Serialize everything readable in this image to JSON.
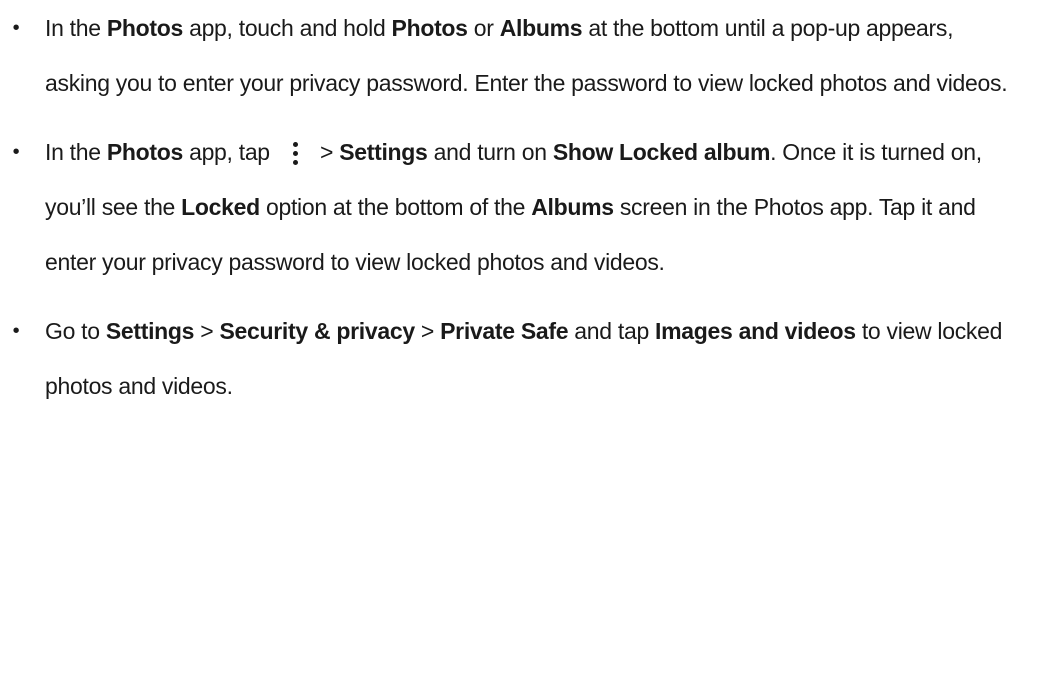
{
  "bullet_glyph": "•",
  "icons": {
    "more": "more-vertical-icon"
  },
  "items": [
    {
      "segments": [
        {
          "t": "In the "
        },
        {
          "t": "Photos",
          "b": true
        },
        {
          "t": " app, touch and hold "
        },
        {
          "t": "Photos",
          "b": true
        },
        {
          "t": " or "
        },
        {
          "t": "Albums",
          "b": true
        },
        {
          "t": " at the bottom until a pop-up appears, asking you to enter your privacy password. Enter the password to view locked photos and videos."
        }
      ]
    },
    {
      "segments": [
        {
          "t": "In the "
        },
        {
          "t": "Photos",
          "b": true
        },
        {
          "t": " app, tap "
        },
        {
          "icon": "more-vertical-icon"
        },
        {
          "t": " > "
        },
        {
          "t": "Settings",
          "b": true
        },
        {
          "t": " and turn on "
        },
        {
          "t": "Show Locked album",
          "b": true
        },
        {
          "t": ". Once it is turned on, you’ll see the "
        },
        {
          "t": "Locked",
          "b": true
        },
        {
          "t": " option at the bottom of the "
        },
        {
          "t": "Albums",
          "b": true
        },
        {
          "t": " screen in the Photos app. Tap it and enter your privacy password to view locked photos and videos."
        }
      ]
    },
    {
      "segments": [
        {
          "t": "Go to "
        },
        {
          "t": "Settings",
          "b": true
        },
        {
          "t": " > "
        },
        {
          "t": "Security & privacy",
          "b": true
        },
        {
          "t": " > "
        },
        {
          "t": "Private Safe",
          "b": true
        },
        {
          "t": " and tap "
        },
        {
          "t": "Images and videos",
          "b": true
        },
        {
          "t": " to view locked photos and videos."
        }
      ]
    }
  ]
}
